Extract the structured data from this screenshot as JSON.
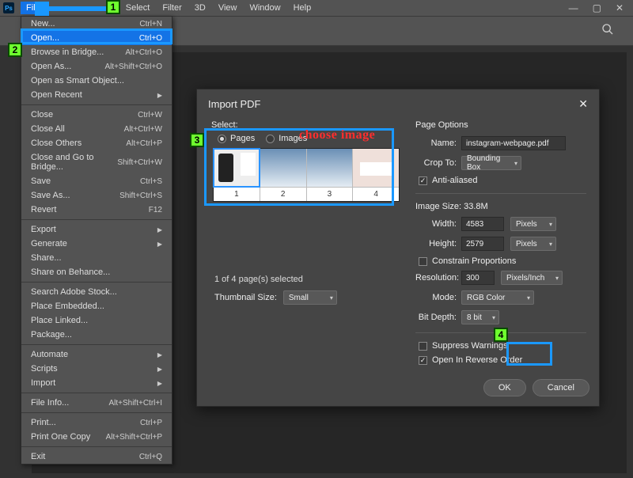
{
  "titlebar": {
    "logo": "Ps",
    "menus": [
      "File",
      "",
      "",
      "",
      "Select",
      "Filter",
      "3D",
      "View",
      "Window",
      "Help"
    ]
  },
  "dropdown": {
    "groups": [
      [
        {
          "label": "New...",
          "shortcut": "Ctrl+N"
        },
        {
          "label": "Open...",
          "shortcut": "Ctrl+O",
          "highlight": true
        },
        {
          "label": "Browse in Bridge...",
          "shortcut": "Alt+Ctrl+O"
        },
        {
          "label": "Open As...",
          "shortcut": "Alt+Shift+Ctrl+O"
        },
        {
          "label": "Open as Smart Object..."
        },
        {
          "label": "Open Recent",
          "submenu": true
        }
      ],
      [
        {
          "label": "Close",
          "shortcut": "Ctrl+W"
        },
        {
          "label": "Close All",
          "shortcut": "Alt+Ctrl+W"
        },
        {
          "label": "Close Others",
          "shortcut": "Alt+Ctrl+P"
        },
        {
          "label": "Close and Go to Bridge...",
          "shortcut": "Shift+Ctrl+W"
        },
        {
          "label": "Save",
          "shortcut": "Ctrl+S"
        },
        {
          "label": "Save As...",
          "shortcut": "Shift+Ctrl+S"
        },
        {
          "label": "Revert",
          "shortcut": "F12"
        }
      ],
      [
        {
          "label": "Export",
          "submenu": true
        },
        {
          "label": "Generate",
          "submenu": true
        },
        {
          "label": "Share..."
        },
        {
          "label": "Share on Behance..."
        }
      ],
      [
        {
          "label": "Search Adobe Stock..."
        },
        {
          "label": "Place Embedded..."
        },
        {
          "label": "Place Linked..."
        },
        {
          "label": "Package..."
        }
      ],
      [
        {
          "label": "Automate",
          "submenu": true
        },
        {
          "label": "Scripts",
          "submenu": true
        },
        {
          "label": "Import",
          "submenu": true
        }
      ],
      [
        {
          "label": "File Info...",
          "shortcut": "Alt+Shift+Ctrl+I"
        }
      ],
      [
        {
          "label": "Print...",
          "shortcut": "Ctrl+P"
        },
        {
          "label": "Print One Copy",
          "shortcut": "Alt+Shift+Ctrl+P"
        }
      ],
      [
        {
          "label": "Exit",
          "shortcut": "Ctrl+Q"
        }
      ]
    ]
  },
  "dialog": {
    "title": "Import PDF",
    "select_label": "Select:",
    "radio_pages": "Pages",
    "radio_images": "Images",
    "thumbs": [
      "1",
      "2",
      "3",
      "4"
    ],
    "status": "1 of 4 page(s) selected",
    "thumbsize_label": "Thumbnail Size:",
    "thumbsize_value": "Small",
    "page_options": "Page Options",
    "name_label": "Name:",
    "name_value": "instagram-webpage.pdf",
    "crop_label": "Crop To:",
    "crop_value": "Bounding Box",
    "antialiased": "Anti-aliased",
    "image_size_label": "Image Size: 33.8M",
    "width_label": "Width:",
    "width_value": "4583",
    "height_label": "Height:",
    "height_value": "2579",
    "unit_px": "Pixels",
    "constrain": "Constrain Proportions",
    "resolution_label": "Resolution:",
    "resolution_value": "300",
    "resolution_unit": "Pixels/Inch",
    "mode_label": "Mode:",
    "mode_value": "RGB Color",
    "bitdepth_label": "Bit Depth:",
    "bitdepth_value": "8 bit",
    "suppress": "Suppress Warnings",
    "reverse": "Open In Reverse Order",
    "ok": "OK",
    "cancel": "Cancel"
  },
  "annotations": {
    "choose": "choose image",
    "n1": "1",
    "n2": "2",
    "n3": "3",
    "n4": "4"
  }
}
